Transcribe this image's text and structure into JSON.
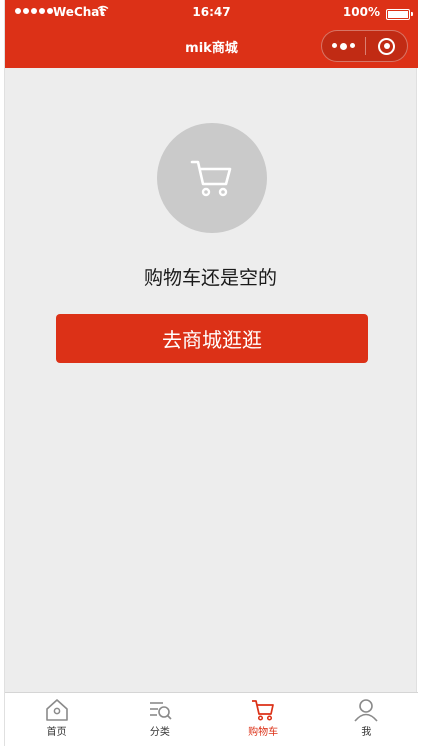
{
  "status_bar": {
    "carrier": "WeChat",
    "time": "16:47",
    "battery": "100%"
  },
  "nav": {
    "title": "mik商城"
  },
  "empty_state": {
    "message": "购物车还是空的",
    "button_label": "去商城逛逛"
  },
  "tabbar": {
    "items": [
      {
        "label": "首页",
        "icon": "home-icon"
      },
      {
        "label": "分类",
        "icon": "category-icon"
      },
      {
        "label": "购物车",
        "icon": "cart-icon",
        "active": true
      },
      {
        "label": "我",
        "icon": "user-icon"
      }
    ]
  },
  "colors": {
    "brand": "#dc3117",
    "background": "#ededed",
    "placeholder_circle": "#cacaca"
  }
}
